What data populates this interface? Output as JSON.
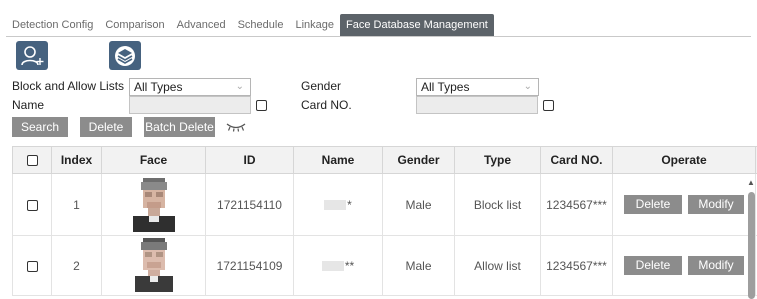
{
  "tabs": [
    {
      "label": "Detection Config"
    },
    {
      "label": "Comparison"
    },
    {
      "label": "Advanced"
    },
    {
      "label": "Schedule"
    },
    {
      "label": "Linkage"
    },
    {
      "label": "Face Database Management"
    }
  ],
  "active_tab": "Face Database Management",
  "toolbar": {
    "add_icon": "add-user-icon",
    "layers_icon": "layers-icon"
  },
  "filters": {
    "block_allow_label": "Block and Allow Lists",
    "block_allow_value": "All Types",
    "gender_label": "Gender",
    "gender_value": "All Types",
    "name_label": "Name",
    "card_label": "Card NO."
  },
  "actions": {
    "search": "Search",
    "delete": "Delete",
    "batch_delete": "Batch Delete"
  },
  "table": {
    "headers": {
      "index": "Index",
      "face": "Face",
      "id": "ID",
      "name": "Name",
      "gender": "Gender",
      "type": "Type",
      "card": "Card NO.",
      "operate": "Operate"
    },
    "rows": [
      {
        "index": "1",
        "id": "1721154110",
        "name_suffix": "*",
        "gender": "Male",
        "type": "Block list",
        "card": "1234567***",
        "delete": "Delete",
        "modify": "Modify"
      },
      {
        "index": "2",
        "id": "1721154109",
        "name_suffix": "**",
        "gender": "Male",
        "type": "Allow list",
        "card": "1234567***",
        "delete": "Delete",
        "modify": "Modify"
      }
    ]
  },
  "colors": {
    "accent_button": "#46627f",
    "active_tab": "#5c6369",
    "gray_button": "#8c8c8c"
  }
}
